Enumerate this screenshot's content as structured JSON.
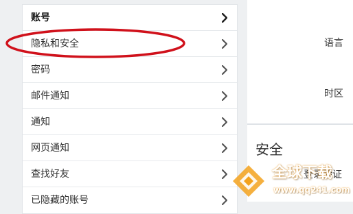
{
  "settings_menu": {
    "items": [
      {
        "label": "账号",
        "active": true
      },
      {
        "label": "隐私和安全",
        "active": false
      },
      {
        "label": "密码",
        "active": false
      },
      {
        "label": "邮件通知",
        "active": false
      },
      {
        "label": "通知",
        "active": false
      },
      {
        "label": "网页通知",
        "active": false
      },
      {
        "label": "查找好友",
        "active": false
      },
      {
        "label": "已隐藏的账号",
        "active": false
      }
    ],
    "chevron_icon": "chevron-right-icon"
  },
  "content": {
    "language_label": "语言",
    "timezone_label": "时区",
    "security_section_title": "安全",
    "login_verification_label": "登录验证"
  },
  "annotation": {
    "highlight_color": "#d0111b"
  },
  "watermark": {
    "title": "全球下载",
    "url": "www.qq241.com"
  }
}
